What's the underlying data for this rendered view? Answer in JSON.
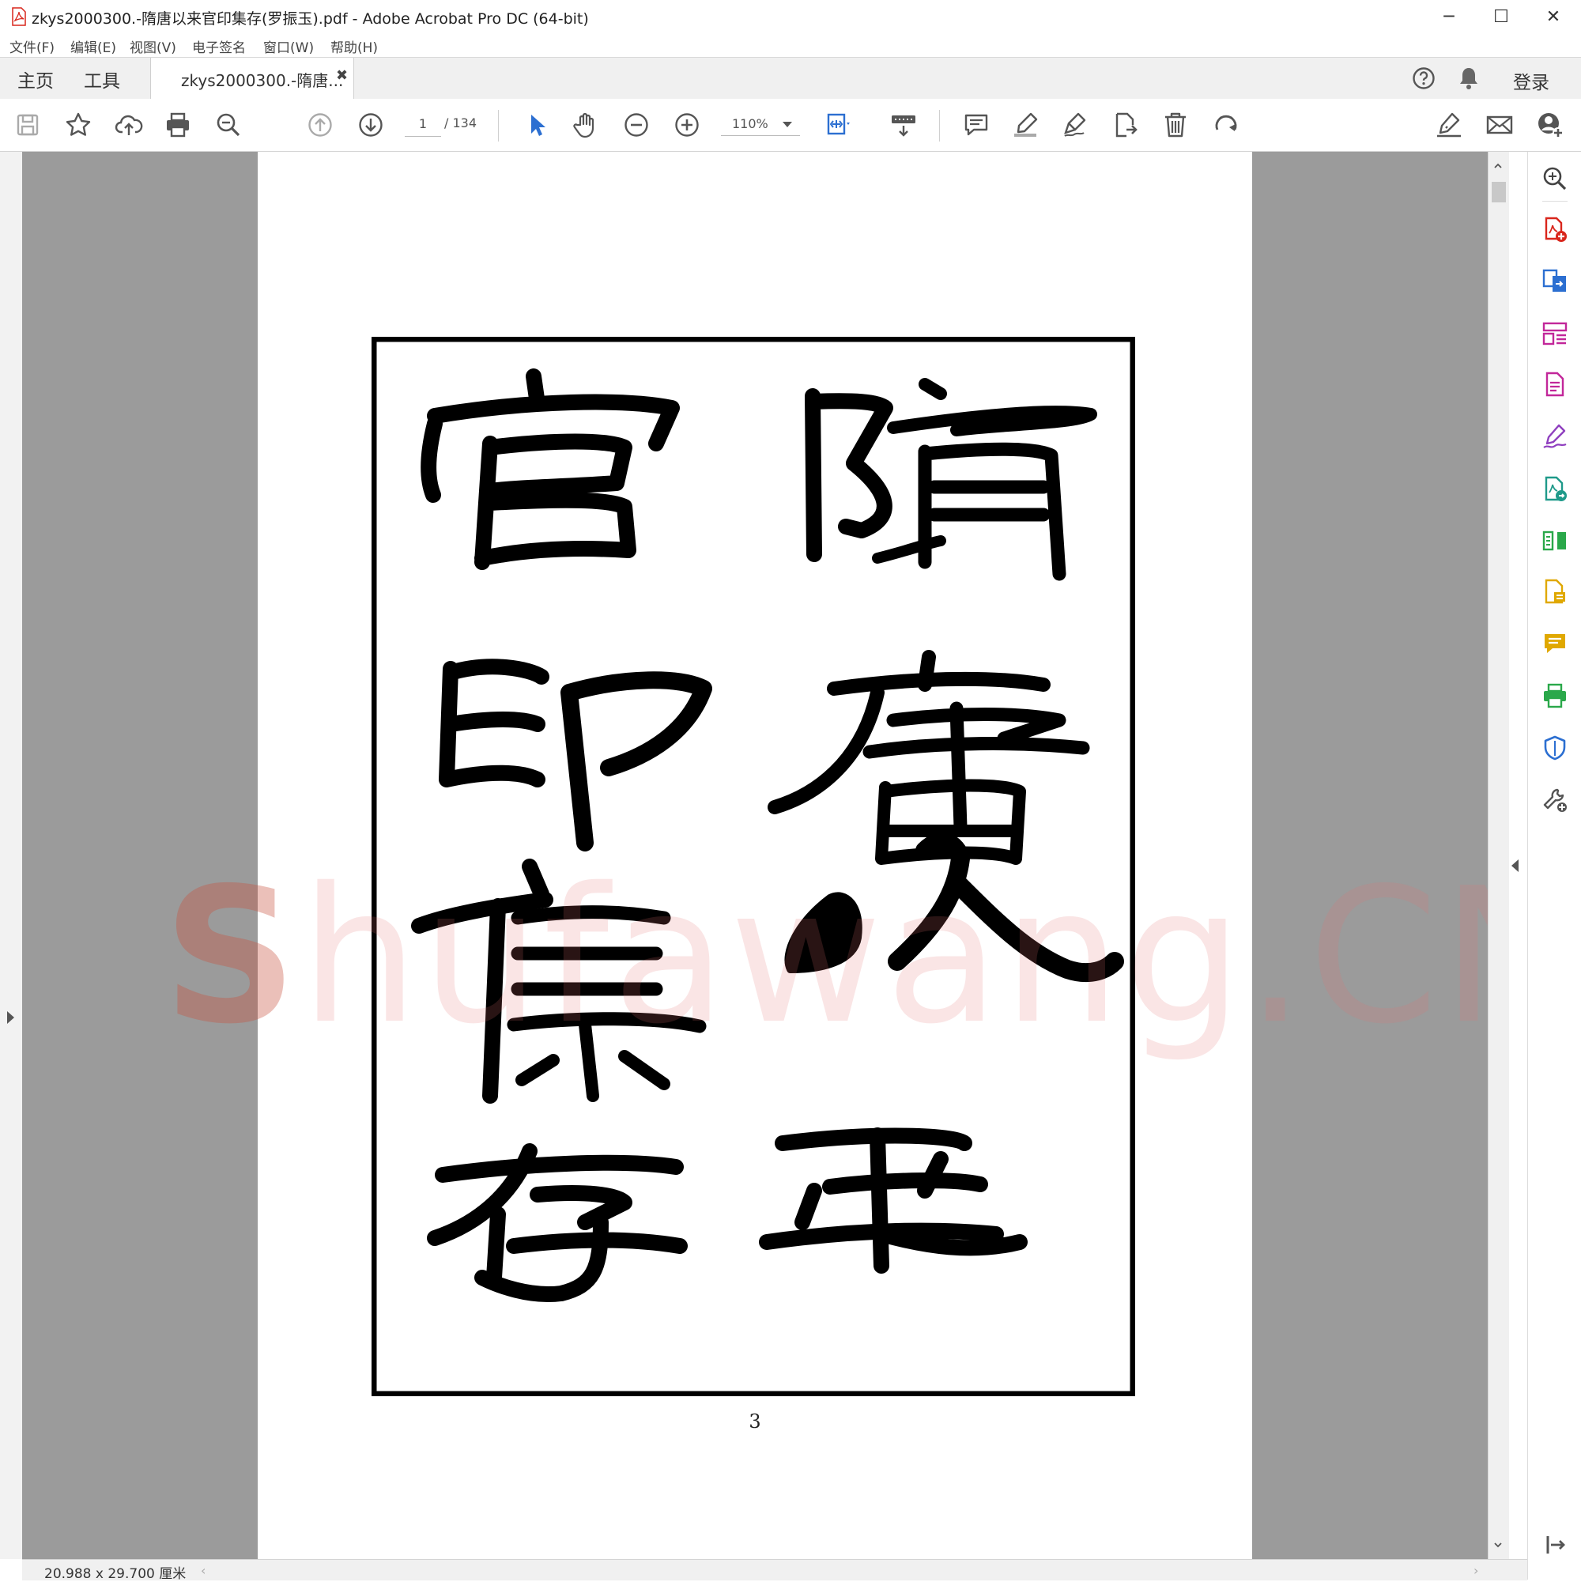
{
  "window": {
    "title": "zkys2000300.-隋唐以来官印集存(罗振玉).pdf - Adobe Acrobat Pro DC (64-bit)",
    "controls": {
      "minimize": "─",
      "maximize": "☐",
      "close": "✕"
    }
  },
  "menu": [
    "文件(F)",
    "编辑(E)",
    "视图(V)",
    "电子签名",
    "窗口(W)",
    "帮助(H)"
  ],
  "tabs": {
    "home": "主页",
    "tools": "工具",
    "document": "zkys2000300.-隋唐...",
    "close": "✖",
    "login": "登录"
  },
  "toolbar": {
    "page_current": "1",
    "page_total": "/ 134",
    "zoom": "110%",
    "icons": [
      "save-icon",
      "bookmark-star-icon",
      "cloud-upload-icon",
      "print-icon",
      "search-zoom-icon",
      "previous-page-icon",
      "next-page-icon",
      "select-arrow-icon",
      "hand-tool-icon",
      "zoom-out-icon",
      "zoom-in-icon",
      "page-fit-icon",
      "keyboard-scroll-icon",
      "comment-icon",
      "highlight-pen-icon",
      "draw-sign-icon",
      "share-export-icon",
      "delete-icon",
      "rotate-icon",
      "sign-icon",
      "email-icon",
      "account-add-icon"
    ]
  },
  "document": {
    "page_number": "3",
    "watermark": "Shufawang.CN",
    "calligraphy_text": [
      "隋唐以來",
      "官印集存"
    ]
  },
  "right_pane_icons": [
    "search-enhance-icon",
    "create-pdf-icon",
    "combine-files-icon",
    "organize-pages-icon",
    "export-pdf-icon",
    "fill-sign-icon",
    "send-for-review-icon",
    "compare-icon",
    "edit-pdf-icon",
    "comment-tool-icon",
    "print-production-icon",
    "protect-shield-icon",
    "more-tools-icon",
    "expand-pane-icon"
  ],
  "colors": {
    "acrobat_red": "#d9261c",
    "blue_accent": "#2c6fd1",
    "magenta": "#c2279a",
    "purple": "#8f3fbf",
    "green": "#2aa84a",
    "yellow": "#e0a800",
    "gray_bg": "#9b9b9b"
  },
  "status": {
    "dimensions": "20.988 x 29.700 厘米"
  }
}
